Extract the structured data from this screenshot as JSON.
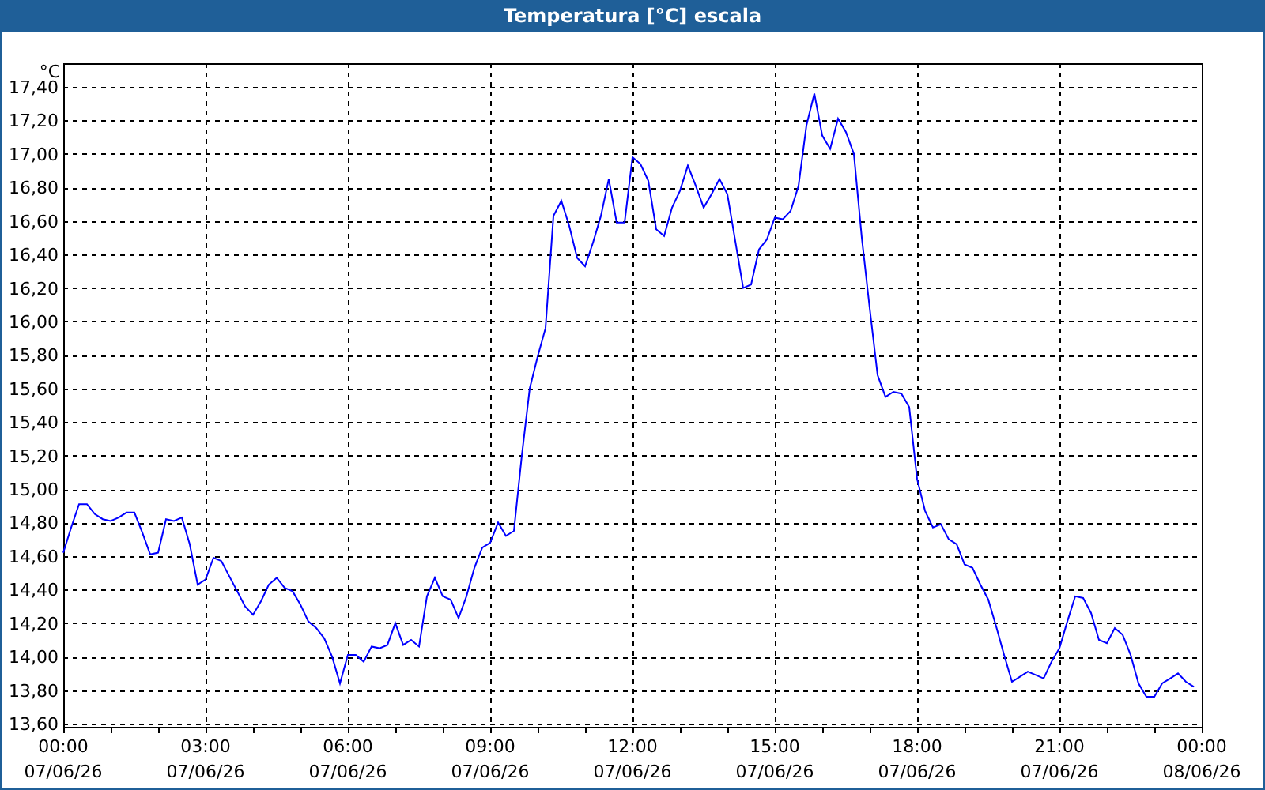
{
  "window": {
    "title": "Temperatura [°C] escala"
  },
  "chart_data": {
    "type": "line",
    "ylabel": "°C",
    "categories": [
      "00:00\n07/06/26",
      null,
      null,
      null,
      null,
      null,
      null,
      null,
      null,
      null,
      null,
      null,
      null,
      null,
      null,
      null,
      null,
      null,
      "03:00\n07/06/26",
      null,
      null,
      null,
      null,
      null,
      null,
      null,
      null,
      null,
      null,
      null,
      null,
      null,
      null,
      null,
      null,
      null,
      "06:00\n07/06/26",
      null,
      null,
      null,
      null,
      null,
      null,
      null,
      null,
      null,
      null,
      null,
      null,
      null,
      null,
      null,
      null,
      null,
      "09:00\n07/06/26",
      null,
      null,
      null,
      null,
      null,
      null,
      null,
      null,
      null,
      null,
      null,
      null,
      null,
      null,
      null,
      null,
      null,
      "12:00\n07/06/26",
      null,
      null,
      null,
      null,
      null,
      null,
      null,
      null,
      null,
      null,
      null,
      null,
      null,
      null,
      null,
      null,
      null,
      "15:00\n07/06/26",
      null,
      null,
      null,
      null,
      null,
      null,
      null,
      null,
      null,
      null,
      null,
      null,
      null,
      null,
      null,
      null,
      null,
      "18:00\n07/06/26",
      null,
      null,
      null,
      null,
      null,
      null,
      null,
      null,
      null,
      null,
      null,
      null,
      null,
      null,
      null,
      null,
      null,
      "21:00\n07/06/26",
      null,
      null,
      null,
      null,
      null,
      null,
      null,
      null,
      null,
      null,
      null,
      null,
      null,
      null,
      null,
      null,
      null,
      "00:00\n08/06/26"
    ],
    "series": [
      {
        "color": "#0000ff",
        "values": [
          14.62,
          14.77,
          14.91,
          14.91,
          14.85,
          14.82,
          14.81,
          14.83,
          14.86,
          14.86,
          14.74,
          14.61,
          14.62,
          14.82,
          14.81,
          14.83,
          14.67,
          14.43,
          14.46,
          14.59,
          14.57,
          14.48,
          14.39,
          14.3,
          14.25,
          14.33,
          14.43,
          14.47,
          14.41,
          14.39,
          14.31,
          14.21,
          14.17,
          14.11,
          14.0,
          13.84,
          14.01,
          14.01,
          13.97,
          14.06,
          14.05,
          14.07,
          14.2,
          14.07,
          14.1,
          14.06,
          14.36,
          14.47,
          14.36,
          14.34,
          14.23,
          14.36,
          14.53,
          14.65,
          14.68,
          14.8,
          14.72,
          14.75,
          15.2,
          15.6,
          15.79,
          15.96,
          16.63,
          16.72,
          16.57,
          16.38,
          16.33,
          16.47,
          16.63,
          16.85,
          16.59,
          16.59,
          16.98,
          16.94,
          16.84,
          16.55,
          16.51,
          16.68,
          16.78,
          16.93,
          16.81,
          16.68,
          16.76,
          16.85,
          16.76,
          16.48,
          16.2,
          16.22,
          16.43,
          16.49,
          16.62,
          16.61,
          16.66,
          16.81,
          17.17,
          17.36,
          17.11,
          17.03,
          17.21,
          17.13,
          17.0,
          16.5,
          16.08,
          15.68,
          15.55,
          15.58,
          15.57,
          15.49,
          15.06,
          14.87,
          14.77,
          14.79,
          14.7,
          14.67,
          14.55,
          14.53,
          14.43,
          14.34,
          14.18,
          14.01,
          13.85,
          13.88,
          13.91,
          13.89,
          13.87,
          13.97,
          14.05,
          14.21,
          14.36,
          14.35,
          14.26,
          14.1,
          14.08,
          14.17,
          14.13,
          14.01,
          13.84,
          13.76,
          13.76,
          13.84,
          13.87,
          13.9,
          13.85,
          13.82,
          null
        ]
      }
    ],
    "grid": true,
    "ylim": [
      13.6,
      17.4
    ],
    "yticks": [
      {
        "value": 13.6,
        "label": "13,60"
      },
      {
        "value": 13.8,
        "label": "13,80"
      },
      {
        "value": 14.0,
        "label": "14,00"
      },
      {
        "value": 14.2,
        "label": "14,20"
      },
      {
        "value": 14.4,
        "label": "14,40"
      },
      {
        "value": 14.6,
        "label": "14,60"
      },
      {
        "value": 14.8,
        "label": "14,80"
      },
      {
        "value": 15.0,
        "label": "15,00"
      },
      {
        "value": 15.2,
        "label": "15,20"
      },
      {
        "value": 15.4,
        "label": "15,40"
      },
      {
        "value": 15.6,
        "label": "15,60"
      },
      {
        "value": 15.8,
        "label": "15,80"
      },
      {
        "value": 16.0,
        "label": "16,00"
      },
      {
        "value": 16.2,
        "label": "16,20"
      },
      {
        "value": 16.4,
        "label": "16,40"
      },
      {
        "value": 16.6,
        "label": "16,60"
      },
      {
        "value": 16.8,
        "label": "16,80"
      },
      {
        "value": 17.0,
        "label": "17,00"
      },
      {
        "value": 17.2,
        "label": "17,20"
      },
      {
        "value": 17.4,
        "label": "17,40"
      }
    ]
  }
}
